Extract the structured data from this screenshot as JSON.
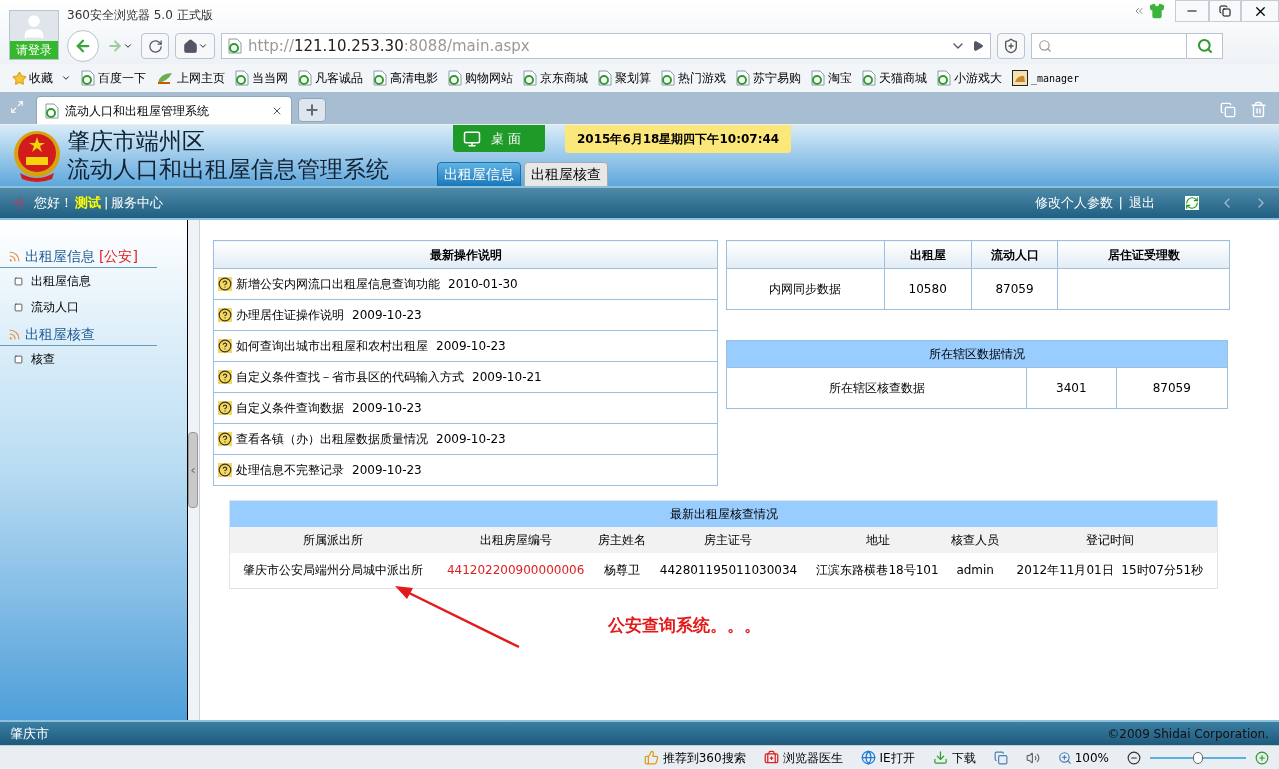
{
  "browser": {
    "title": "360安全浏览器 5.0 正式版",
    "login": "请登录",
    "url": {
      "scheme": "http://",
      "host": "121.10.253.30",
      "rest": ":8088/main.aspx"
    },
    "favorites": "收藏",
    "bookmarks": [
      {
        "label": "百度一下",
        "kind": "page"
      },
      {
        "label": "上网主页",
        "kind": "hao"
      },
      {
        "label": "当当网",
        "kind": "page"
      },
      {
        "label": "凡客诚品",
        "kind": "page"
      },
      {
        "label": "高清电影",
        "kind": "page"
      },
      {
        "label": "购物网站",
        "kind": "page"
      },
      {
        "label": "京东商城",
        "kind": "page"
      },
      {
        "label": "聚划算",
        "kind": "page"
      },
      {
        "label": "热门游戏",
        "kind": "page"
      },
      {
        "label": "苏宁易购",
        "kind": "page"
      },
      {
        "label": "淘宝",
        "kind": "page"
      },
      {
        "label": "天猫商城",
        "kind": "page"
      },
      {
        "label": "小游戏大",
        "kind": "page"
      },
      {
        "label": "_manager",
        "kind": "image"
      }
    ],
    "tabs": [
      {
        "label": "流动人口和出租屋管理系统",
        "selected": true
      }
    ]
  },
  "app": {
    "title_line1": "肇庆市端州区",
    "title_line2": "流动人口和出租屋信息管理系统",
    "desktop": "桌 面",
    "datetime": "2015年6月18星期四下午10:07:44",
    "tabs": [
      {
        "label": "出租屋信息",
        "selected": true
      },
      {
        "label": "出租屋核查",
        "selected": false
      }
    ],
    "greeting": "您好！",
    "user": "测试",
    "separator": "|",
    "service": "服务中心",
    "settings": "修改个人参数",
    "settings_separator": "|",
    "logout": "退出"
  },
  "sidebar": [
    {
      "title": "出租屋信息",
      "tag": "[公安]",
      "items": [
        "出租屋信息",
        "流动人口"
      ]
    },
    {
      "title": "出租屋核查",
      "items": [
        "核查"
      ]
    }
  ],
  "guide": {
    "title": "最新操作说明",
    "items": [
      {
        "text": "新增公安内网流口出租屋信息查询功能",
        "date": "2010-01-30"
      },
      {
        "text": "办理居住证操作说明",
        "date": "2009-10-23"
      },
      {
        "text": "如何查询出城市出租屋和农村出租屋",
        "date": "2009-10-23"
      },
      {
        "text": "自定义条件查找－省市县区的代码输入方式",
        "date": "2009-10-21"
      },
      {
        "text": "自定义条件查询数据",
        "date": "2009-10-23"
      },
      {
        "text": "查看各镇（办）出租屋数据质量情况",
        "date": "2009-10-23"
      },
      {
        "text": "处理信息不完整记录",
        "date": "2009-10-23"
      }
    ]
  },
  "sync": {
    "columns": [
      "出租屋",
      "流动人口",
      "居住证受理数"
    ],
    "row": [
      "内网同步数据",
      "10580",
      "87059"
    ]
  },
  "district": {
    "title": "所在辖区数据情况",
    "row": [
      "所在辖区核查数据",
      "3401",
      "87059"
    ]
  },
  "checks": {
    "title": "最新出租屋核查情况",
    "columns": [
      "所属派出所",
      "出租房屋编号",
      "房主姓名",
      "房主证号",
      "地址",
      "核查人员",
      "登记时间"
    ],
    "rows": [
      [
        "肇庆市公安局端州分局城中派出所",
        "441202200900000006",
        "杨尊卫",
        "442801195011030034",
        "江滨东路横巷18号101",
        "admin",
        "2012年11月01日  15时07分51秒"
      ]
    ]
  },
  "annotation": "公安查询系统。。。",
  "footer": {
    "city": "肇庆市",
    "copyright": "©2009 Shidai Corporation."
  },
  "status_bar": {
    "items": [
      {
        "label": "推荐到360搜索",
        "kind": "thumb"
      },
      {
        "label": "浏览器医生",
        "kind": "medic"
      },
      {
        "label": "IE打开",
        "kind": "ie"
      },
      {
        "label": "下载",
        "kind": "download"
      }
    ],
    "zoom": "100%",
    "zoom_slider": {
      "level": 0.5
    }
  }
}
